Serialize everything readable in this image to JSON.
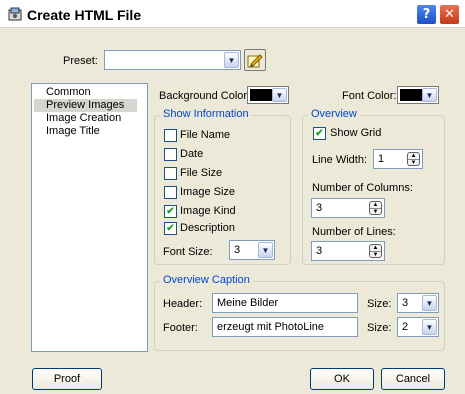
{
  "window": {
    "title": "Create HTML File",
    "help_glyph": "?",
    "close_glyph": "✕",
    "icons": [
      "app-icon",
      "help-icon",
      "close-icon"
    ]
  },
  "preset": {
    "label": "Preset:",
    "value": "",
    "edit_icon": "edit-pencil-icon"
  },
  "categories": [
    "Common",
    "Preview Images",
    "Image Creation",
    "Image Title"
  ],
  "selected_category": "Preview Images",
  "colors": {
    "background_label": "Background Color:",
    "background_value": "#000000",
    "font_label": "Font Color:",
    "font_value": "#000000"
  },
  "show_information": {
    "title": "Show Information",
    "items": [
      {
        "label": "File Name",
        "checked": false
      },
      {
        "label": "Date",
        "checked": false
      },
      {
        "label": "File Size",
        "checked": false
      },
      {
        "label": "Image Size",
        "checked": false
      },
      {
        "label": "Image Kind",
        "checked": true
      },
      {
        "label": "Description",
        "checked": true
      }
    ],
    "font_size_label": "Font Size:",
    "font_size_value": "3"
  },
  "overview": {
    "title": "Overview",
    "show_grid_label": "Show Grid",
    "show_grid_checked": true,
    "line_width_label": "Line Width:",
    "line_width_value": "1",
    "columns_label": "Number of Columns:",
    "columns_value": "3",
    "lines_label": "Number of Lines:",
    "lines_value": "3"
  },
  "caption": {
    "title": "Overview Caption",
    "header_label": "Header:",
    "header_value": "Meine Bilder",
    "header_size_label": "Size:",
    "header_size_value": "3",
    "footer_label": "Footer:",
    "footer_value": "erzeugt mit PhotoLine",
    "footer_size_label": "Size:",
    "footer_size_value": "2"
  },
  "buttons": {
    "proof": "Proof",
    "ok": "OK",
    "cancel": "Cancel"
  },
  "glyphs": {
    "dropdown": "▼",
    "up": "▲",
    "down": "▼",
    "check": "✔"
  }
}
